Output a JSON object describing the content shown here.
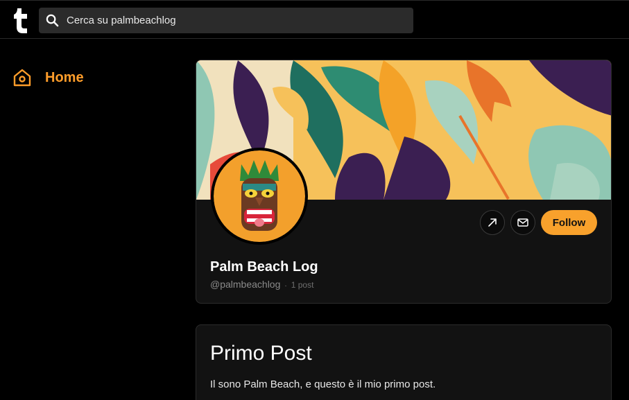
{
  "topbar": {
    "logo_icon": "tumblr-t-icon",
    "search_placeholder": "Cerca su palmbeachlog"
  },
  "sidebar": {
    "items": [
      {
        "label": "Home",
        "icon": "home-icon",
        "color": "#ff9d2a"
      }
    ]
  },
  "blog": {
    "title": "Palm Beach Log",
    "handle": "@palmbeachlog",
    "separator": "·",
    "post_count": "1 post",
    "actions": {
      "share_icon": "arrow-up-right-icon",
      "message_icon": "mail-icon",
      "follow_label": "Follow"
    },
    "accent_color": "#f8a12c"
  },
  "post": {
    "title": "Primo Post",
    "body": "Il sono Palm Beach, e questo è il mio primo post."
  }
}
